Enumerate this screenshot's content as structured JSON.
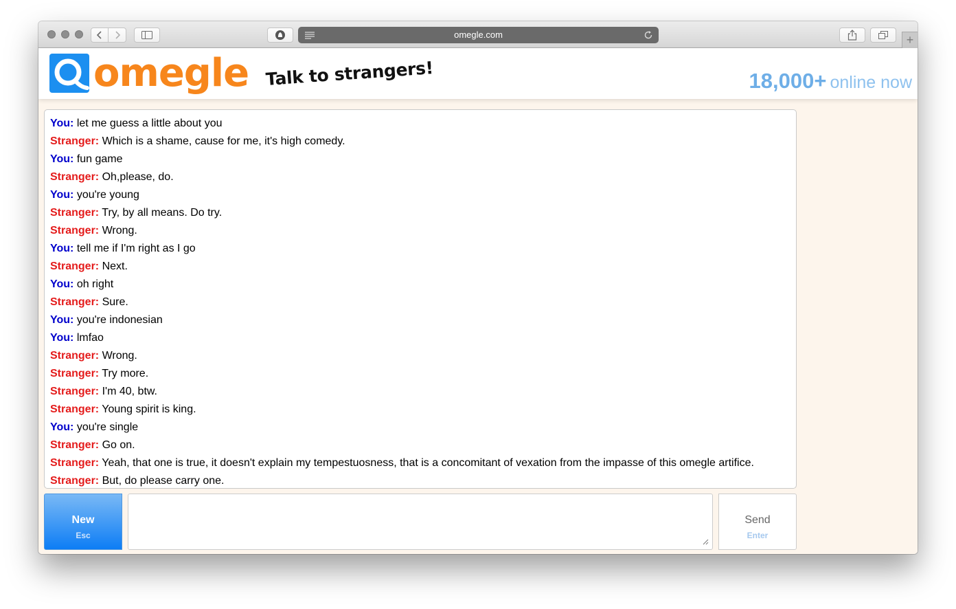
{
  "browser": {
    "url": "omegle.com",
    "new_tab_symbol": "+"
  },
  "header": {
    "logo_text": "omegle",
    "tagline": "Talk to strangers!",
    "online_count": "18,000+",
    "online_label": "online now"
  },
  "chat": {
    "messages": [
      {
        "speaker": "You:",
        "text": "let me guess a little about you",
        "role": "you"
      },
      {
        "speaker": "Stranger:",
        "text": "Which is a shame, cause for me, it's high comedy.",
        "role": "stranger"
      },
      {
        "speaker": "You:",
        "text": "fun game",
        "role": "you"
      },
      {
        "speaker": "Stranger:",
        "text": "Oh,please, do.",
        "role": "stranger"
      },
      {
        "speaker": "You:",
        "text": "you're young",
        "role": "you"
      },
      {
        "speaker": "Stranger:",
        "text": "Try, by all means. Do try.",
        "role": "stranger"
      },
      {
        "speaker": "Stranger:",
        "text": "Wrong.",
        "role": "stranger"
      },
      {
        "speaker": "You:",
        "text": "tell me if I'm right as I go",
        "role": "you"
      },
      {
        "speaker": "Stranger:",
        "text": "Next.",
        "role": "stranger"
      },
      {
        "speaker": "You:",
        "text": "oh right",
        "role": "you"
      },
      {
        "speaker": "Stranger:",
        "text": "Sure.",
        "role": "stranger"
      },
      {
        "speaker": "You:",
        "text": "you're indonesian",
        "role": "you"
      },
      {
        "speaker": "You:",
        "text": "lmfao",
        "role": "you"
      },
      {
        "speaker": "Stranger:",
        "text": "Wrong.",
        "role": "stranger"
      },
      {
        "speaker": "Stranger:",
        "text": "Try more.",
        "role": "stranger"
      },
      {
        "speaker": "Stranger:",
        "text": "I'm 40, btw.",
        "role": "stranger"
      },
      {
        "speaker": "Stranger:",
        "text": "Young spirit is king.",
        "role": "stranger"
      },
      {
        "speaker": "You:",
        "text": "you're single",
        "role": "you"
      },
      {
        "speaker": "Stranger:",
        "text": "Go on.",
        "role": "stranger"
      },
      {
        "speaker": "Stranger:",
        "text": "Yeah, that one is true, it doesn't explain my tempestuosness, that is a concomitant of vexation from the impasse of this omegle artifice.",
        "role": "stranger"
      },
      {
        "speaker": "Stranger:",
        "text": "But, do please carry one.",
        "role": "stranger"
      }
    ],
    "input_value": ""
  },
  "controls": {
    "new_label": "New",
    "new_hint": "Esc",
    "send_label": "Send",
    "send_hint": "Enter"
  },
  "colors": {
    "you": "#0000cc",
    "stranger": "#e41b1b",
    "brand_orange": "#f7861c",
    "brand_blue": "#1c8ff0",
    "page_bg": "#fdf5ec"
  },
  "icons": [
    "back-icon",
    "forward-icon",
    "sidebar-icon",
    "privacy-shield-icon",
    "reader-icon",
    "reload-icon",
    "share-icon",
    "tabs-icon",
    "omegle-logo-icon",
    "resize-grip-icon"
  ]
}
